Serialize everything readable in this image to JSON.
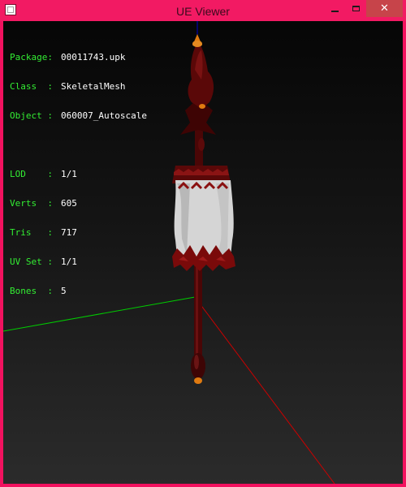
{
  "window": {
    "title": "UE Viewer",
    "controls": {
      "minimize_glyph": "",
      "maximize_glyph": "",
      "close_glyph": "✕"
    },
    "accent": "#f2105f"
  },
  "overlay": {
    "group1": [
      {
        "label": "Package:",
        "value": "00011743.upk"
      },
      {
        "label": "Class  :",
        "value": "SkeletalMesh"
      },
      {
        "label": "Object :",
        "value": "060007_Autoscale"
      }
    ],
    "group2": [
      {
        "label": "LOD    :",
        "value": "1/1"
      },
      {
        "label": "Verts  :",
        "value": "605"
      },
      {
        "label": "Tris   :",
        "value": "717"
      },
      {
        "label": "UV Set :",
        "value": "1/1"
      },
      {
        "label": "Bones  :",
        "value": "5"
      }
    ],
    "label_color": "#33ee33",
    "value_color": "#ffffff"
  },
  "scene": {
    "axis_x_color": "#00cc00",
    "axis_y_color": "#cc0000",
    "axis_z_color": "#0000cc",
    "mesh_colors": {
      "dark_red": "#4a0606",
      "red": "#7a0e0e",
      "cloth": "#d8d8d8",
      "tip": "#e07a10"
    }
  }
}
